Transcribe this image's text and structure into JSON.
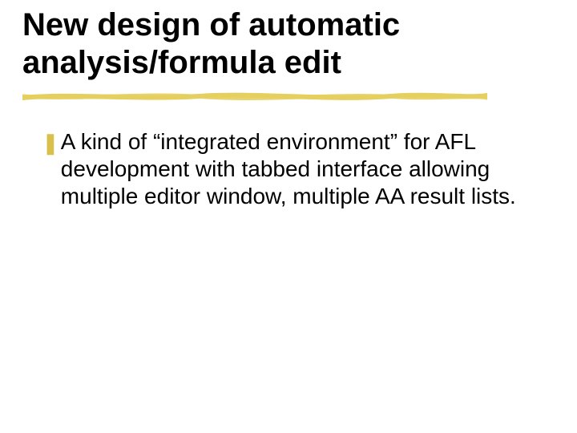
{
  "title": "New design of automatic analysis/formula edit",
  "bullets": [
    {
      "glyph": "❚",
      "text": "A kind of “integrated environment” for AFL development with tabbed interface allowing multiple editor window, multiple AA result lists."
    }
  ],
  "colors": {
    "bullet": "#d9c04a",
    "underline_stroke": "#e4cf5f"
  }
}
